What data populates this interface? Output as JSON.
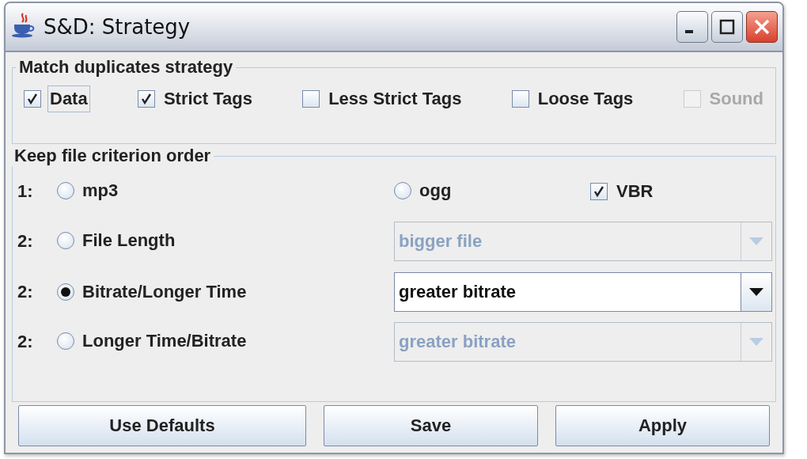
{
  "window": {
    "title": "S&D: Strategy"
  },
  "match_group": {
    "title": "Match duplicates strategy",
    "options": [
      {
        "label": "Data",
        "checked": true,
        "disabled": false,
        "focused": true
      },
      {
        "label": "Strict Tags",
        "checked": true,
        "disabled": false,
        "focused": false
      },
      {
        "label": "Less Strict Tags",
        "checked": false,
        "disabled": false,
        "focused": false
      },
      {
        "label": "Loose Tags",
        "checked": false,
        "disabled": false,
        "focused": false
      },
      {
        "label": "Sound",
        "checked": false,
        "disabled": true,
        "focused": false
      }
    ]
  },
  "criteria": {
    "title": "Keep file criterion order",
    "rows": [
      {
        "kind": "types",
        "number": "1:",
        "options": [
          {
            "kind": "radio",
            "label": "mp3",
            "selected": false
          },
          {
            "kind": "radio",
            "label": "ogg",
            "selected": false
          },
          {
            "kind": "checkbox",
            "label": "VBR",
            "checked": true
          }
        ]
      },
      {
        "kind": "choice",
        "number": "2:",
        "label": "File Length",
        "selected": false,
        "dropdown": {
          "value": "bigger file",
          "disabled": true
        }
      },
      {
        "kind": "choice",
        "number": "2:",
        "label": "Bitrate/Longer Time",
        "selected": true,
        "dropdown": {
          "value": "greater bitrate",
          "disabled": false
        }
      },
      {
        "kind": "choice",
        "number": "2:",
        "label": "Longer Time/Bitrate",
        "selected": false,
        "dropdown": {
          "value": "greater bitrate",
          "disabled": true
        }
      }
    ]
  },
  "buttons": [
    {
      "label": "Use Defaults"
    },
    {
      "label": "Save"
    },
    {
      "label": "Apply"
    }
  ]
}
